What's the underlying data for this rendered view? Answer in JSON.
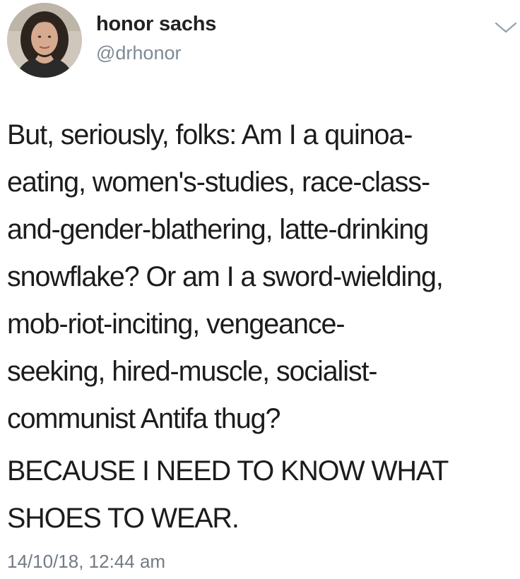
{
  "user": {
    "display_name": "honor sachs",
    "handle": "@drhonor",
    "avatar_icon": "profile-photo"
  },
  "menu": {
    "icon": "chevron-down-icon"
  },
  "tweet": {
    "body_lines": [
      "But, seriously, folks: Am I a quinoa-",
      "eating, women's-studies, race-class-",
      "and-gender-blathering, latte-drinking",
      "snowflake? Or am I a sword-wielding,",
      "mob-riot-inciting, vengeance-",
      "seeking, hired-muscle, socialist-",
      "communist Antifa thug?"
    ],
    "shout_lines": [
      "BECAUSE I NEED TO KNOW WHAT",
      "SHOES TO WEAR."
    ],
    "timestamp": "14/10/18, 12:44 am"
  },
  "colors": {
    "text": "#1c1c1c",
    "muted": "#737b84",
    "background": "#ffffff"
  }
}
